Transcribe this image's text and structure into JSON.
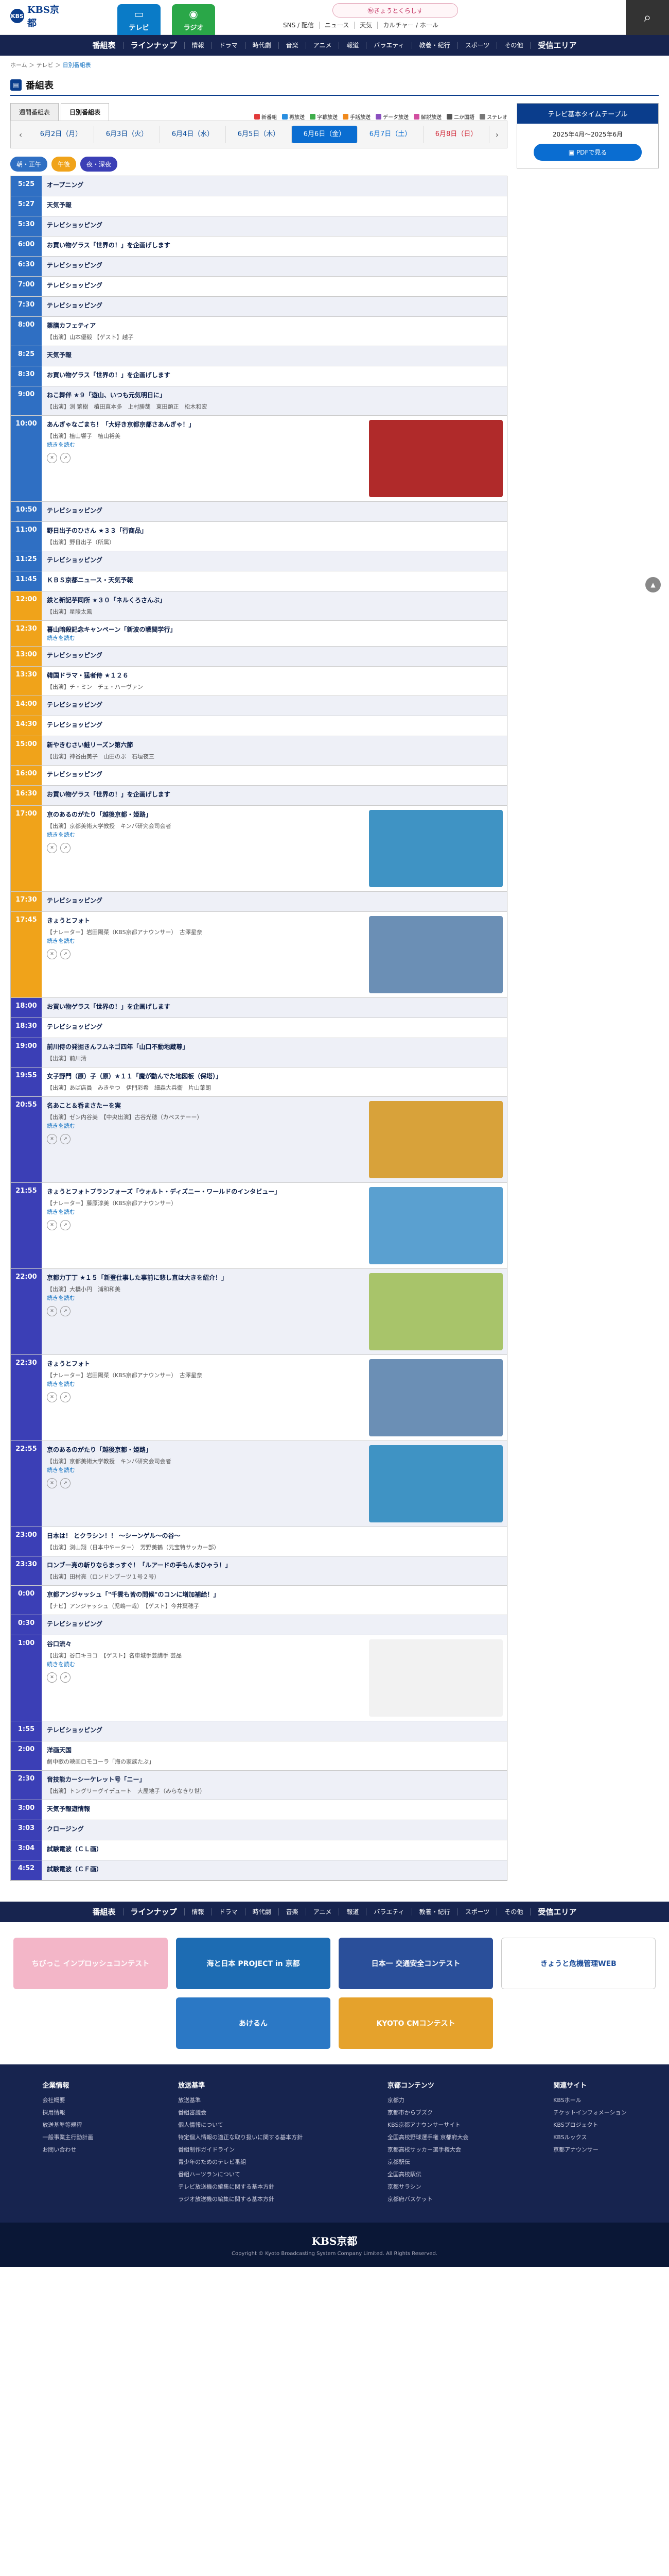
{
  "header": {
    "logo_mark": "KBS",
    "logo_text": "KBS京都",
    "tab_tv": "テレビ",
    "tab_radio": "ラジオ",
    "banner": "㊗きょうとくらしす",
    "links": [
      "SNS / 配信",
      "ニュース",
      "天気",
      "カルチャー / ホール"
    ]
  },
  "nav": [
    "番組表",
    "ラインナップ",
    "情報",
    "ドラマ",
    "時代劇",
    "音楽",
    "アニメ",
    "報道",
    "バラエティ",
    "教養・紀行",
    "スポーツ",
    "その他",
    "受信エリア"
  ],
  "breadcrumb": {
    "home": "ホーム",
    "sep": " ＞ ",
    "tv": "テレビ",
    "current": "日別番組表"
  },
  "page_title": "番組表",
  "switch_tabs": [
    "週間番組表",
    "日別番組表"
  ],
  "genres": [
    {
      "label": "新番組",
      "color": "#e23b3b"
    },
    {
      "label": "再放送",
      "color": "#2a8fe0"
    },
    {
      "label": "字幕放送",
      "color": "#3fae4c"
    },
    {
      "label": "手話放送",
      "color": "#f08a1d"
    },
    {
      "label": "データ放送",
      "color": "#8a4fbf"
    },
    {
      "label": "解説放送",
      "color": "#d24fa0"
    },
    {
      "label": "二か国語",
      "color": "#555555"
    },
    {
      "label": "ステレオ",
      "color": "#777777"
    }
  ],
  "dates": [
    "6月2日（月）",
    "6月3日（火）",
    "6月4日（水）",
    "6月5日（木）",
    "6月6日（金）",
    "6月7日（土）",
    "6月8日（日）"
  ],
  "timezones": [
    {
      "label": "朝・正午",
      "color": "#2f6fc3"
    },
    {
      "label": "午後",
      "color": "#f0a31a"
    },
    {
      "label": "夜・深夜",
      "color": "#3b3fb6"
    }
  ],
  "programs": [
    {
      "time": "5:25",
      "z": "m",
      "title": "オープニング"
    },
    {
      "time": "5:27",
      "z": "m",
      "title": "天気予報"
    },
    {
      "time": "5:30",
      "z": "m",
      "title": "テレビショッピング"
    },
    {
      "time": "6:00",
      "z": "m",
      "title": "お買い物ゲラス「世界の！」を企画げします"
    },
    {
      "time": "6:30",
      "z": "m",
      "title": "テレビショッピング"
    },
    {
      "time": "7:00",
      "z": "m",
      "title": "テレビショッピング"
    },
    {
      "time": "7:30",
      "z": "m",
      "title": "テレビショッピング"
    },
    {
      "time": "8:00",
      "z": "m",
      "title": "薬膳カフェティア",
      "desc": "【出演】山本優毅 【ゲスト】越子"
    },
    {
      "time": "8:25",
      "z": "m",
      "title": "天気予報"
    },
    {
      "time": "8:30",
      "z": "m",
      "title": "お買い物ゲラス「世界の！」を企画げします"
    },
    {
      "time": "9:00",
      "z": "m",
      "title": "ねこ舞伴 ★９「遊山、いつも元気明日に」",
      "desc": "【出演】渕 繁樹　植田直本多　上村勝哉　東田顕正　松木和宏"
    },
    {
      "time": "10:00",
      "z": "m",
      "title": "あんぎゃなごまち！「大好き京都京都さあんぎゃ！」",
      "desc": "【出演】植山響子　植山裕美",
      "more": "続きを読む",
      "thumb": "#b02a2a"
    },
    {
      "time": "10:50",
      "z": "m",
      "title": "テレビショッピング"
    },
    {
      "time": "11:00",
      "z": "m",
      "title": "野日出子のひさん ★３３「行商品」",
      "desc": "【出演】野日出子（所属）"
    },
    {
      "time": "11:25",
      "z": "m",
      "title": "テレビショッピング"
    },
    {
      "time": "11:45",
      "z": "m",
      "title": "ＫＢＳ京都ニュース・天気予報"
    },
    {
      "time": "12:00",
      "z": "a",
      "title": "鉄と新記芋同所 ★３０「ネルくろさんぶ」",
      "desc": "【出演】星陵太鳳"
    },
    {
      "time": "12:30",
      "z": "a",
      "title": "暮山暗殺記念キャンペーン「新波の戦闘学行」",
      "more": "続きを読む"
    },
    {
      "time": "13:00",
      "z": "a",
      "title": "テレビショッピング"
    },
    {
      "time": "13:30",
      "z": "a",
      "title": "韓国ドラマ・猛者侍 ★１２６",
      "desc": "【出演】チ・ミン　チェ・ハーヴァン"
    },
    {
      "time": "14:00",
      "z": "a",
      "title": "テレビショッピング"
    },
    {
      "time": "14:30",
      "z": "a",
      "title": "テレビショッピング"
    },
    {
      "time": "15:00",
      "z": "a",
      "title": "新やきむさい鮭リーズン第六節",
      "desc": "【出演】神谷由美子　山田のぶ　石垣夜三"
    },
    {
      "time": "16:00",
      "z": "a",
      "title": "テレビショッピング"
    },
    {
      "time": "16:30",
      "z": "a",
      "title": "お買い物ゲラス「世界の！」を企画げします"
    },
    {
      "time": "17:00",
      "z": "a",
      "title": "京のあるのがたり「越後京都・姫路」",
      "desc": "【出演】京都美術大学教授　キンバ研究会司会者",
      "more": "続きを読む",
      "thumb": "#3f93c4"
    },
    {
      "time": "17:30",
      "z": "a",
      "title": "テレビショッピング"
    },
    {
      "time": "17:45",
      "z": "a",
      "title": "きょうとフォト",
      "desc": "【ナレーター】岩田陽菜（KBS京都アナウンサー）　古澤星奈",
      "more": "続きを読む",
      "thumb": "#6b8fb5"
    },
    {
      "time": "18:00",
      "z": "n",
      "title": "お買い物ゲラス「世界の！」を企画げします"
    },
    {
      "time": "18:30",
      "z": "n",
      "title": "テレビショッピング"
    },
    {
      "time": "19:00",
      "z": "n",
      "title": "前川侍の発掘きんフムネゴ四年「山口不動地蔵尊」",
      "desc": "【出演】前川清"
    },
    {
      "time": "19:55",
      "z": "n",
      "title": "女子野門（原）子（原）★１１「魔が動んでた地図板（保塔）」",
      "desc": "【出演】あば店員　みきやつ　伊門彩希　細森大兵衛　片山葉朗"
    },
    {
      "time": "20:55",
      "z": "n",
      "title": "名あこと＆呑まさたーを実",
      "desc": "【出演】ゼン内谷美　【中央出演】古谷光穂（カペステーー）",
      "more": "続きを読む",
      "thumb": "#d8a23a"
    },
    {
      "time": "21:55",
      "z": "n",
      "title": "きょうとフォトプランフォーズ「ウォルト・ディズニー・ワールドのインタビュー」",
      "desc": "【ナレーター】藤原淳美（KBS京都アナウンサー）",
      "more": "続きを読む",
      "thumb": "#5aa0d0"
    },
    {
      "time": "22:00",
      "z": "n",
      "title": "京都力丁丁 ★１５「新登仕事した事前に悲し直は大きを紹介！」",
      "desc": "【出演】大橋小円　浦和和美",
      "more": "続きを読む",
      "thumb": "#a8c46a"
    },
    {
      "time": "22:30",
      "z": "n",
      "title": "きょうとフォト",
      "desc": "【ナレーター】岩田陽菜（KBS京都アナウンサー）　古澤星奈",
      "more": "続きを読む",
      "thumb": "#6b8fb5"
    },
    {
      "time": "22:55",
      "z": "n",
      "title": "京のあるのがたり「越後京都・姫路」",
      "desc": "【出演】京都美術大学教授　キンバ研究会司会者",
      "more": "続きを読む",
      "thumb": "#3f93c4"
    },
    {
      "time": "23:00",
      "z": "n",
      "title": "日本は！ とクラシン！！ ～シーンゲル～の谷～",
      "desc": "【出演】渕山翔（日本中やーター）　芳野美鶴（元宝特サッカー部）"
    },
    {
      "time": "23:30",
      "z": "n",
      "title": "ロンブー亮の斬りならまっすぐ！「ルアードの手もんまひゃう！」",
      "desc": "【出演】田村亮（ロンドンブーツ１号２号）"
    },
    {
      "time": "0:00",
      "z": "n",
      "title": "京都アンジャッシュ「\"千雲も皆の問候\"のコンに増加補給！」",
      "desc": "【ナビ】アンジャッシュ（児嶋一哉）　【ゲスト】今井葉穂子"
    },
    {
      "time": "0:30",
      "z": "n",
      "title": "テレビショッピング"
    },
    {
      "time": "1:00",
      "z": "n",
      "title": "谷口流々",
      "desc": "【出演】谷口キヨコ　【ゲスト】名車城手芸講手 芸品",
      "more": "続きを読む",
      "thumb": "#f2f2f2"
    },
    {
      "time": "1:55",
      "z": "n",
      "title": "テレビショッピング"
    },
    {
      "time": "2:00",
      "z": "n",
      "title": "洋画天国",
      "desc": "劇中歌の映画ロモコーラ「海の家族たぶ」"
    },
    {
      "time": "2:30",
      "z": "n",
      "title": "音技能カーシーケレット号「ニー」",
      "desc": "【出演】トングリーグイデュート　大屋地子（みらなきり世）"
    },
    {
      "time": "3:00",
      "z": "n",
      "title": "天気予報遊情報"
    },
    {
      "time": "3:03",
      "z": "n",
      "title": "クロージング"
    },
    {
      "time": "3:04",
      "z": "n",
      "title": "試験電波（ＣＬ画）"
    },
    {
      "time": "4:52",
      "z": "n",
      "title": "試験電波（ＣＦ画）"
    }
  ],
  "right_box": {
    "title": "テレビ基本タイムテーブル",
    "period": "2025年4月〜2025年6月",
    "pdf": "PDFで見る"
  },
  "ads": [
    {
      "label": "ちびっこ インプロッシュコンテスト",
      "color": "#f3b6c8"
    },
    {
      "label": "海と日本 PROJECT in 京都",
      "color": "#1d6cb3"
    },
    {
      "label": "日本一 交通安全コンテスト",
      "color": "#2a4f9a"
    },
    {
      "label": "きょうと危機管理WEB",
      "color": "#ffffff"
    },
    {
      "label": "あけるん",
      "color": "#2b78c5"
    },
    {
      "label": "KYOTO CMコンテスト",
      "color": "#e5a22c"
    }
  ],
  "footer": {
    "cols": [
      {
        "h": "企業情報",
        "items": [
          "会社概要",
          "採用情報",
          "放送基準等規程",
          "一般事業主行動計画",
          "お問い合わせ"
        ]
      },
      {
        "h": "放送基準",
        "items": [
          "放送基準",
          "番組審議会",
          "個人情報について",
          "特定個人情報の適正な取り扱いに関する基本方針",
          "番組制作ガイドライン",
          "青少年のためのテレビ番組",
          "番組ハーツランについて",
          "テレビ放送機の編集に関する基本方針",
          "ラジオ放送機の編集に関する基本方針"
        ]
      },
      {
        "h": "京都コンテンツ",
        "items": [
          "京都力",
          "京都市からブズク",
          "KBS京都アナウンサーサイト",
          "全国高校野球選手権 京都府大会",
          "京都高校サッカー選手権大会",
          "京都駅伝",
          "全国高校駅伝",
          "京都サラシン",
          "京都府バスケット"
        ]
      },
      {
        "h": "関連サイト",
        "items": [
          "KBSホール",
          "チケットインフォメーション",
          "KBSプロジェクト",
          "KBSルックス",
          "京都アナウンサー"
        ]
      }
    ],
    "logo": "KBS京都",
    "copy": "Copyright © Kyoto Broadcasting System Company Limited. All Rights Reserved."
  }
}
